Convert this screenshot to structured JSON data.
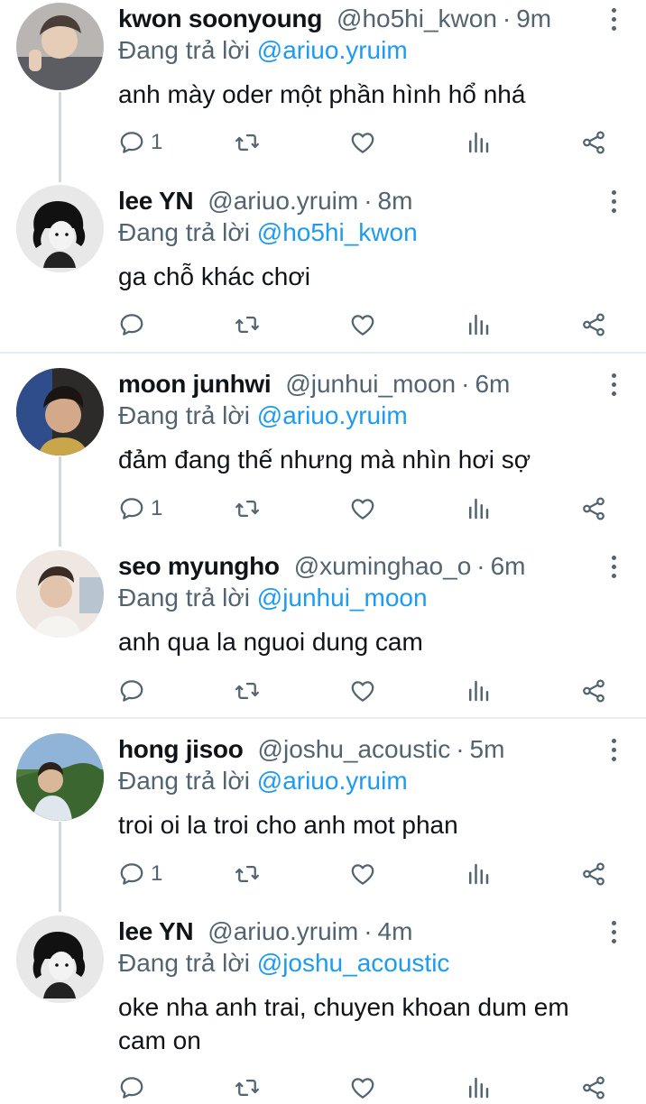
{
  "tweets": [
    {
      "name": "kwon soonyoung",
      "handle": "@ho5hi_kwon",
      "time": "9m",
      "reply_prefix": "Đang trả lời",
      "reply_to": "@ariuo.yruim",
      "text": "anh mày oder một phần hình hổ nhá",
      "reply_count": "1"
    },
    {
      "name": "lee YN",
      "handle": "@ariuo.yruim",
      "time": "8m",
      "reply_prefix": "Đang trả lời",
      "reply_to": "@ho5hi_kwon",
      "text": "ga chỗ khác chơi",
      "reply_count": ""
    },
    {
      "name": "moon junhwi",
      "handle": "@junhui_moon",
      "time": "6m",
      "reply_prefix": "Đang trả lời",
      "reply_to": "@ariuo.yruim",
      "text": "đảm đang thế nhưng mà nhìn hơi sợ",
      "reply_count": "1"
    },
    {
      "name": "seo myungho",
      "handle": "@xuminghao_o",
      "time": "6m",
      "reply_prefix": "Đang trả lời",
      "reply_to": "@junhui_moon",
      "text": "anh qua la nguoi dung cam",
      "reply_count": ""
    },
    {
      "name": "hong jisoo",
      "handle": "@joshu_acoustic",
      "time": "5m",
      "reply_prefix": "Đang trả lời",
      "reply_to": "@ariuo.yruim",
      "text": "troi oi la troi cho anh mot phan",
      "reply_count": "1"
    },
    {
      "name": "lee YN",
      "handle": "@ariuo.yruim",
      "time": "4m",
      "reply_prefix": "Đang trả lời",
      "reply_to": "@joshu_acoustic",
      "text": "oke nha anh trai, chuyen khoan dum em cam on",
      "reply_count": ""
    }
  ],
  "separator": "·",
  "icons": {
    "reply": "comment-icon",
    "retweet": "retweet-icon",
    "like": "heart-icon",
    "views": "analytics-icon",
    "share": "share-icon",
    "more": "more-options-icon"
  },
  "colors": {
    "link": "#1d9bf0",
    "secondary": "#536471",
    "text": "#0f1419"
  }
}
